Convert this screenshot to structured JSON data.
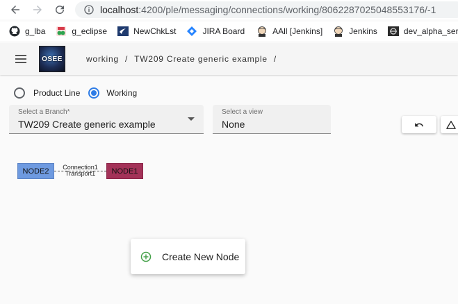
{
  "browser": {
    "url_host": "localhost",
    "url_path": ":4200/ple/messaging/connections/working/8062287025048553176/-1",
    "bookmarks": [
      {
        "label": "g_lba",
        "icon": "github-icon"
      },
      {
        "label": "g_eclipse",
        "icon": "eclipse-icon"
      },
      {
        "label": "NewChkLst",
        "icon": "checklist-icon"
      },
      {
        "label": "JIRA Board",
        "icon": "jira-icon"
      },
      {
        "label": "AAll [Jenkins]",
        "icon": "jenkins-icon"
      },
      {
        "label": "Jenkins",
        "icon": "jenkins-icon"
      },
      {
        "label": "dev_alpha_serv",
        "icon": "server-icon"
      }
    ]
  },
  "header": {
    "logo_text": "OSEE",
    "breadcrumbs": [
      "working",
      "TW209 Create generic example"
    ]
  },
  "branch_type": {
    "options": [
      "Product Line",
      "Working"
    ],
    "selected": "Working"
  },
  "branch_select": {
    "label": "Select a Branch*",
    "value": "TW209 Create generic example"
  },
  "view_select": {
    "label": "Select a view",
    "value": "None"
  },
  "graph": {
    "nodes": [
      {
        "id": "NODE2",
        "color": "#6e9ae0"
      },
      {
        "id": "NODE1",
        "color": "#a33258"
      }
    ],
    "edge": {
      "name": "Connection1",
      "transport": "Transport1"
    }
  },
  "context_menu": {
    "items": [
      {
        "label": "Create New Node",
        "icon": "add-circle-icon"
      }
    ]
  },
  "colors": {
    "accent": "#2e7ce6",
    "add_icon": "#43a047"
  }
}
